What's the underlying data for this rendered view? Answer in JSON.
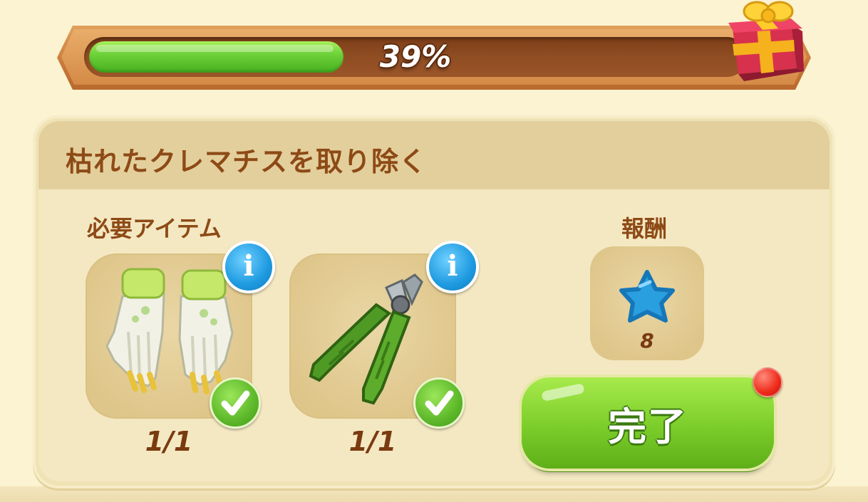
{
  "progress": {
    "percent_text": "39%",
    "fill_fraction": 0.39
  },
  "reward_box_icon": "gift-box-icon",
  "task": {
    "title": "枯れたクレマチスを取り除く"
  },
  "required": {
    "label": "必要アイテム",
    "items": [
      {
        "icon": "gardening-gloves-icon",
        "count": "1/1",
        "complete": true
      },
      {
        "icon": "pruning-shears-icon",
        "count": "1/1",
        "complete": true
      }
    ]
  },
  "reward": {
    "label": "報酬",
    "icon": "blue-star-icon",
    "amount": "8"
  },
  "complete_button": {
    "label": "完了"
  },
  "colors": {
    "accent_green": "#7bcd2a",
    "title_brown": "#8d4a16",
    "info_blue": "#1e9ae0",
    "notify_red": "#ee2a1a"
  }
}
